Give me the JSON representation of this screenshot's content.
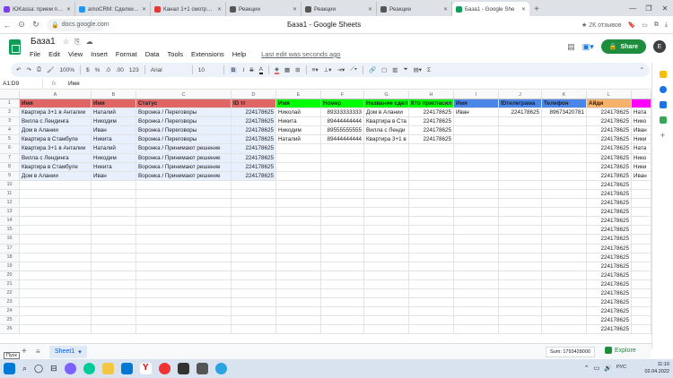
{
  "browser": {
    "tabs": [
      {
        "title": "ЮKassa: прием плате",
        "color": "#7b3fe4"
      },
      {
        "title": "amoCRM: Сделки, Ес",
        "color": "#2196f3"
      },
      {
        "title": "Канал 1+1 смотреть",
        "color": "#e53935"
      },
      {
        "title": "Реакции",
        "color": "#555555"
      },
      {
        "title": "Реакции",
        "color": "#555555"
      },
      {
        "title": "Реакции",
        "color": "#555555"
      },
      {
        "title": "База1 - Google She",
        "color": "#0f9d58"
      }
    ],
    "url": "docs.google.com",
    "page_title": "База1 - Google Sheets",
    "reviews": "2К отзывов"
  },
  "sheets": {
    "doc_title": "База1",
    "menu": [
      "File",
      "Edit",
      "View",
      "Insert",
      "Format",
      "Data",
      "Tools",
      "Extensions",
      "Help"
    ],
    "last_edit": "Last edit was seconds ago",
    "share_label": "Share",
    "account_initial": "E",
    "toolbar": {
      "zoom": "100%",
      "currency": "$",
      "percent": "%",
      "dec_less": ".0",
      "dec_more": ".00",
      "format": "123",
      "font": "Arial",
      "font_size": "10",
      "bold": "B",
      "italic": "I",
      "strike": "S",
      "text_color": "A",
      "sum": "Σ"
    },
    "name_box": "A1:D9",
    "fx": "fx",
    "formula": "Имя",
    "columns": [
      {
        "label": "",
        "w": 22
      },
      {
        "label": "A",
        "w": 80
      },
      {
        "label": "B",
        "w": 50
      },
      {
        "label": "C",
        "w": 106
      },
      {
        "label": "D",
        "w": 50
      },
      {
        "label": "E",
        "w": 50
      },
      {
        "label": "F",
        "w": 48
      },
      {
        "label": "G",
        "w": 50
      },
      {
        "label": "H",
        "w": 50
      },
      {
        "label": "I",
        "w": 50
      },
      {
        "label": "J",
        "w": 48
      },
      {
        "label": "K",
        "w": 50
      },
      {
        "label": "L",
        "w": 50
      },
      {
        "label": "",
        "w": 22
      }
    ],
    "header_row": [
      "Имя",
      "Имя",
      "Статус",
      "ID тг",
      "Имя",
      "Номер",
      "Название сделки",
      "Кто пригласил",
      "Имя",
      "IDтелеграма",
      "Телефон",
      "Айди",
      ""
    ],
    "data_rows": [
      [
        "Квартира 3+1 в Анталии",
        "Наталий",
        "Воронка / Переговоры",
        "224178625",
        "Николай",
        "89333333333",
        "Дом в Алании",
        "224178625",
        "Иван",
        "224178625",
        "89673420781",
        "224178625",
        "Ната"
      ],
      [
        "Вилла с Лендинга",
        "Никодим",
        "Воронка / Переговоры",
        "224178625",
        "Никита",
        "89444444444",
        "Квартира в Ста",
        "224178625",
        "",
        "",
        "",
        "224178625",
        "Нико"
      ],
      [
        "Дом в Алании",
        "Иван",
        "Воронка / Переговоры",
        "224178625",
        "Никодим",
        "89555555555",
        "Вилла с Ленди",
        "224178625",
        "",
        "",
        "",
        "224178625",
        "Иван"
      ],
      [
        "Квартира в Стамбуле",
        "Никита",
        "Воронка / Переговоры",
        "224178625",
        "Наталий",
        "89444444444",
        "Квартира 3+1 в",
        "224178625",
        "",
        "",
        "",
        "224178625",
        "Ники"
      ],
      [
        "Квартира 3+1 в Анталии",
        "Наталий",
        "Воронка / Принимают решение",
        "224178625",
        "",
        "",
        "",
        "",
        "",
        "",
        "",
        "224178625",
        "Ната"
      ],
      [
        "Вилла с Лендинга",
        "Никодим",
        "Воронка / Принимают решение",
        "224178625",
        "",
        "",
        "",
        "",
        "",
        "",
        "",
        "224178625",
        "Нико"
      ],
      [
        "Квартира в Стамбуле",
        "Никита",
        "Воронка / Принимают решение",
        "224178625",
        "",
        "",
        "",
        "",
        "",
        "",
        "",
        "224178625",
        "Ники"
      ],
      [
        "Дом в Алании",
        "Иван",
        "Воронка / Принимают решение",
        "224178625",
        "",
        "",
        "",
        "",
        "",
        "",
        "",
        "224178625",
        "Иван"
      ]
    ],
    "l_column_value": "224178625",
    "sheet_tab": "Sheet1",
    "sum_label": "Sum: 1793428000",
    "explore_label": "Explore",
    "tooltip": "Пуск"
  },
  "taskbar": {
    "time": "11:10",
    "date": "02.04.2022",
    "lang": "РУС"
  }
}
